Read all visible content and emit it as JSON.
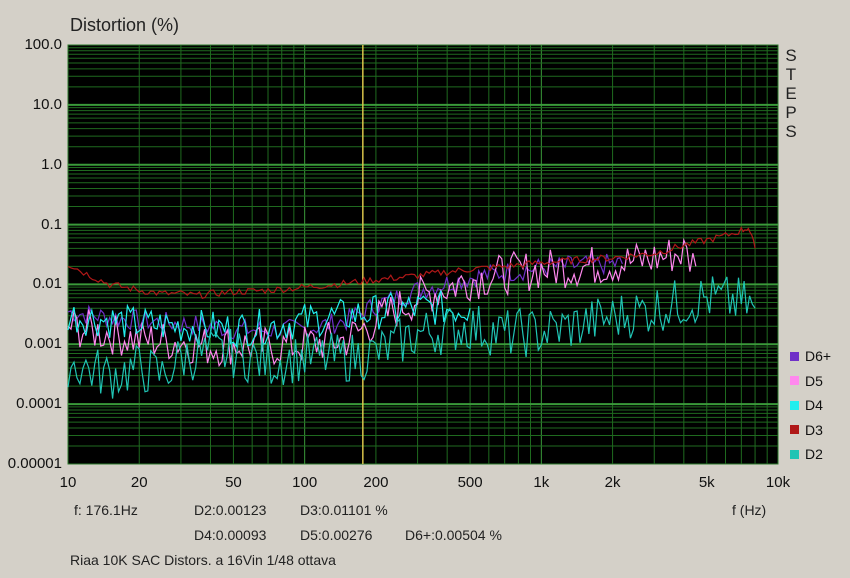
{
  "chart_data": {
    "type": "line",
    "title": "Distortion (%)",
    "xlabel": "f (Hz)",
    "ylabel": "Distortion (%)",
    "xscale": "log",
    "yscale": "log",
    "xlim": [
      10,
      10000
    ],
    "ylim": [
      1e-05,
      100
    ],
    "x_ticks": [
      "10",
      "20",
      "50",
      "100",
      "200",
      "500",
      "1k",
      "2k",
      "5k",
      "10k"
    ],
    "y_ticks": [
      "100.0",
      "10.0",
      "1.0",
      "0.1",
      "0.01",
      "0.001",
      "0.0001",
      "0.00001"
    ],
    "grid": true,
    "cursor_frequency": 176.1,
    "side_label": "STEPS",
    "legend_position": "bottom-right",
    "series": [
      {
        "name": "D6+",
        "color": "#7030c8",
        "x": [
          10,
          15,
          20,
          30,
          40,
          50,
          70,
          100,
          150,
          200,
          300,
          500,
          700,
          1000,
          1500,
          2000,
          2200
        ],
        "y": [
          0.0035,
          0.0028,
          0.0025,
          0.0022,
          0.002,
          0.0018,
          0.0017,
          0.0018,
          0.0025,
          0.0045,
          0.008,
          0.013,
          0.016,
          0.019,
          0.021,
          0.022,
          0.022
        ]
      },
      {
        "name": "D5",
        "color": "#ff88ee",
        "x": [
          10,
          15,
          20,
          30,
          40,
          50,
          70,
          100,
          150,
          200,
          300,
          500,
          700,
          1000,
          1500,
          2000,
          3000,
          4000,
          4500
        ],
        "y": [
          0.002,
          0.0015,
          0.0012,
          0.0011,
          0.0009,
          0.001,
          0.0009,
          0.001,
          0.0012,
          0.0025,
          0.006,
          0.012,
          0.015,
          0.018,
          0.02,
          0.022,
          0.027,
          0.035,
          0.02
        ]
      },
      {
        "name": "D4",
        "color": "#22eeee",
        "x": [
          10,
          15,
          20,
          30,
          50,
          70,
          100,
          150,
          200,
          300,
          500
        ],
        "y": [
          0.003,
          0.0025,
          0.0022,
          0.002,
          0.0018,
          0.002,
          0.0025,
          0.003,
          0.0035,
          0.004,
          0.004
        ]
      },
      {
        "name": "D3",
        "color": "#b01818",
        "x": [
          10,
          12,
          15,
          20,
          25,
          30,
          35,
          40,
          50,
          70,
          100,
          150,
          200,
          300,
          500,
          700,
          1000,
          1500,
          2000,
          3000,
          4000,
          5000,
          6000,
          7000,
          7500,
          8000
        ],
        "y": [
          0.022,
          0.015,
          0.01,
          0.008,
          0.007,
          0.007,
          0.0065,
          0.007,
          0.0075,
          0.008,
          0.009,
          0.0105,
          0.012,
          0.014,
          0.018,
          0.02,
          0.023,
          0.026,
          0.028,
          0.033,
          0.045,
          0.055,
          0.065,
          0.08,
          0.09,
          0.04
        ]
      },
      {
        "name": "D2",
        "color": "#20c4b4",
        "x": [
          10,
          15,
          20,
          25,
          30,
          40,
          50,
          70,
          100,
          150,
          200,
          300,
          500,
          700,
          1000,
          1500,
          2000,
          3000,
          5000,
          7000,
          8000
        ],
        "y": [
          0.0005,
          0.0003,
          0.0004,
          0.0003,
          0.0006,
          0.0007,
          0.0007,
          0.0005,
          0.0006,
          0.0006,
          0.0007,
          0.0015,
          0.002,
          0.0015,
          0.0016,
          0.0022,
          0.0028,
          0.004,
          0.006,
          0.005,
          0.004
        ]
      }
    ]
  },
  "readout": {
    "freq": "f: 176.1Hz",
    "d2": "D2:0.00123",
    "d3": "D3:0.01101 %",
    "d4": "D4:0.00093",
    "d5": "D5:0.00276",
    "d6": "D6+:0.00504 %",
    "caption": "Riaa 10K SAC Distors. a 16Vin 1/48 ottava"
  }
}
